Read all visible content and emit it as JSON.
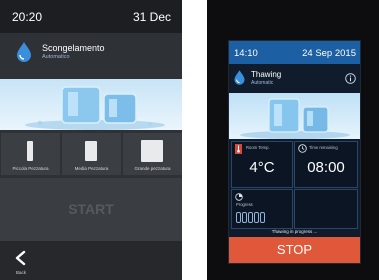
{
  "left": {
    "status": {
      "time": "20:20",
      "date": "31 Dec"
    },
    "header": {
      "title": "Scongelamento",
      "subtitle": "Automatico"
    },
    "options": [
      {
        "label": "Piccola Pezzatura"
      },
      {
        "label": "Media Pezzatura"
      },
      {
        "label": "Grande pezzatura"
      }
    ],
    "start_label": "START",
    "footer": {
      "back_label": "Back"
    }
  },
  "right": {
    "status": {
      "time": "14:10",
      "date": "24 Sep 2015"
    },
    "header": {
      "title": "Thawing",
      "subtitle": "Automatic"
    },
    "room_temp": {
      "label": "Room Temp.",
      "value": "4°C"
    },
    "time_remaining": {
      "label": "Time remaining",
      "value": "08:00"
    },
    "progress": {
      "label": "Progress"
    },
    "status_text": "Thawing in progress ...",
    "stop_label": "STOP"
  },
  "colors": {
    "blue": "#1c5fa2",
    "stop": "#e0583a",
    "left_bg": "#2e3135",
    "right_bg": "#101c2c"
  },
  "icons": [
    "water-drop-icon",
    "back-chevron-icon",
    "info-icon",
    "thermometer-icon",
    "clock-icon",
    "progress-icon"
  ]
}
